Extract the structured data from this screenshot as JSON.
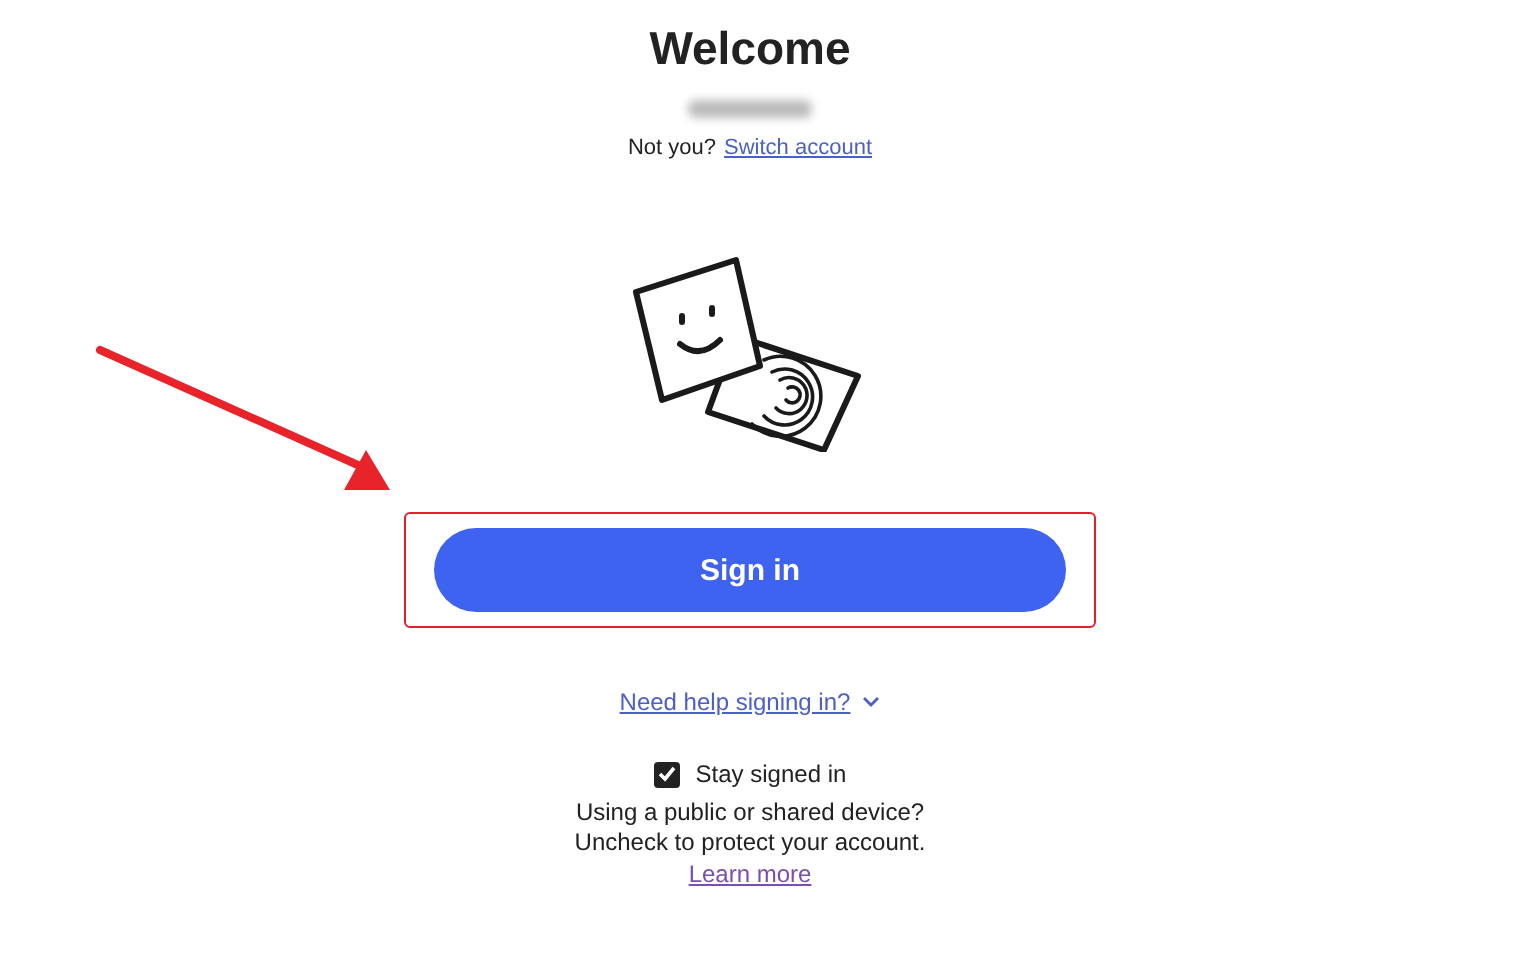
{
  "heading": "Welcome",
  "account": {
    "prompt": "Not you?",
    "switch_link": "Switch account"
  },
  "sign_in_button": {
    "label": "Sign in",
    "highlighted": true
  },
  "pointer_arrow": true,
  "help_link": {
    "label": "Need help signing in?",
    "expanded": false
  },
  "stay_signed_in": {
    "label": "Stay signed in",
    "checked": true
  },
  "notice": "Using a public or shared device?\nUncheck to protect your account.",
  "learn_more_link": "Learn more"
}
